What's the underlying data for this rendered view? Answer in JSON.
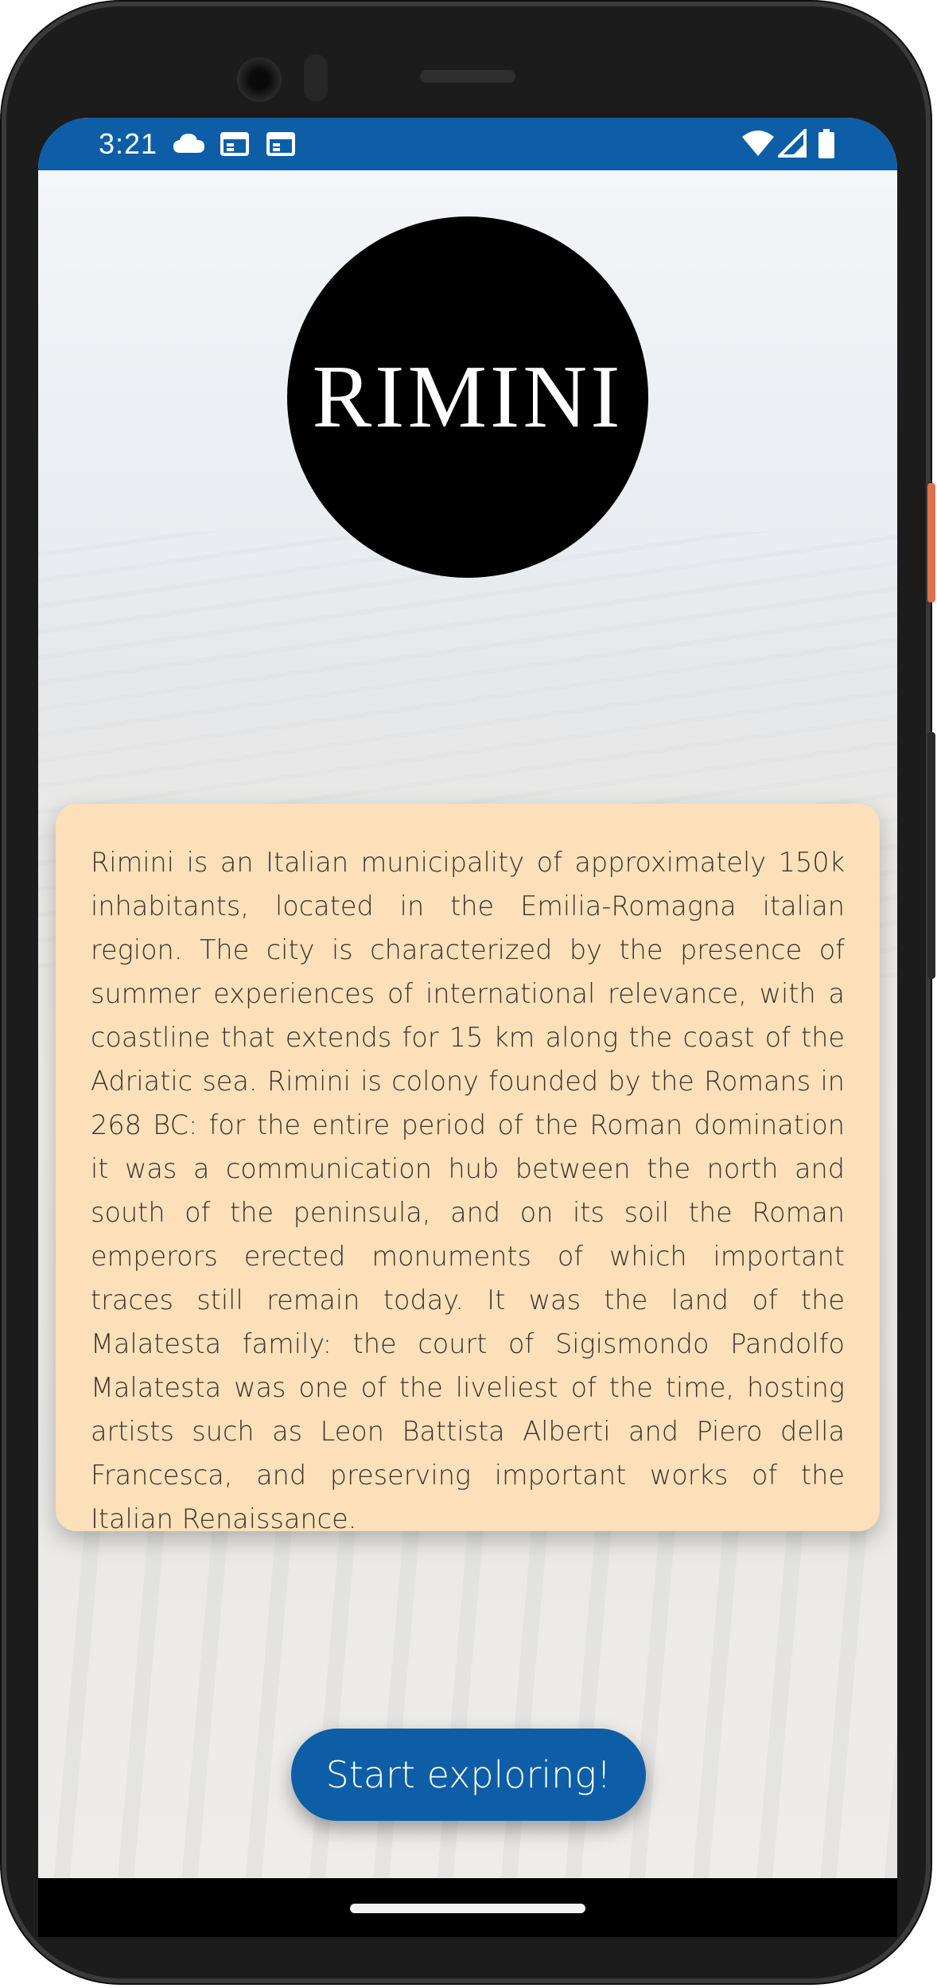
{
  "status_bar": {
    "time": "3:21",
    "left_icons": [
      "cloud-icon",
      "calendar-icon",
      "calendar-icon"
    ],
    "right_icons": [
      "wifi-icon",
      "signal-icon",
      "battery-icon"
    ],
    "background_color": "#0d5ea6"
  },
  "logo": {
    "text": "RIMINI",
    "background_color": "#000000",
    "text_color": "#ffffff"
  },
  "info_card": {
    "text": "Rimini is an Italian municipality of approximately 150k inhabitants, located in the Emilia-Romagna italian region. The city is characterized by the presence of summer experiences of international relevance, with a coastline that extends for 15 km along the coast of the Adriatic sea. Rimini is colony founded by the Romans in 268 BC: for the entire period of the Roman domination it was a communication hub between the north and south of the peninsula, and on its soil the Roman emperors erected monuments of which important traces still remain today. It was the land of the Malatesta family: the court of Sigismondo Pandolfo Malatesta was one of the liveliest of the time, hosting artists such as Leon Battista Alberti and Piero della Francesca, and preserving important works of the Italian Renaissance.",
    "background_color": "#fce0b9"
  },
  "cta": {
    "label": "Start exploring!",
    "background_color": "#0d5ea6"
  },
  "nav_bar": {
    "home_indicator": "home-indicator"
  }
}
